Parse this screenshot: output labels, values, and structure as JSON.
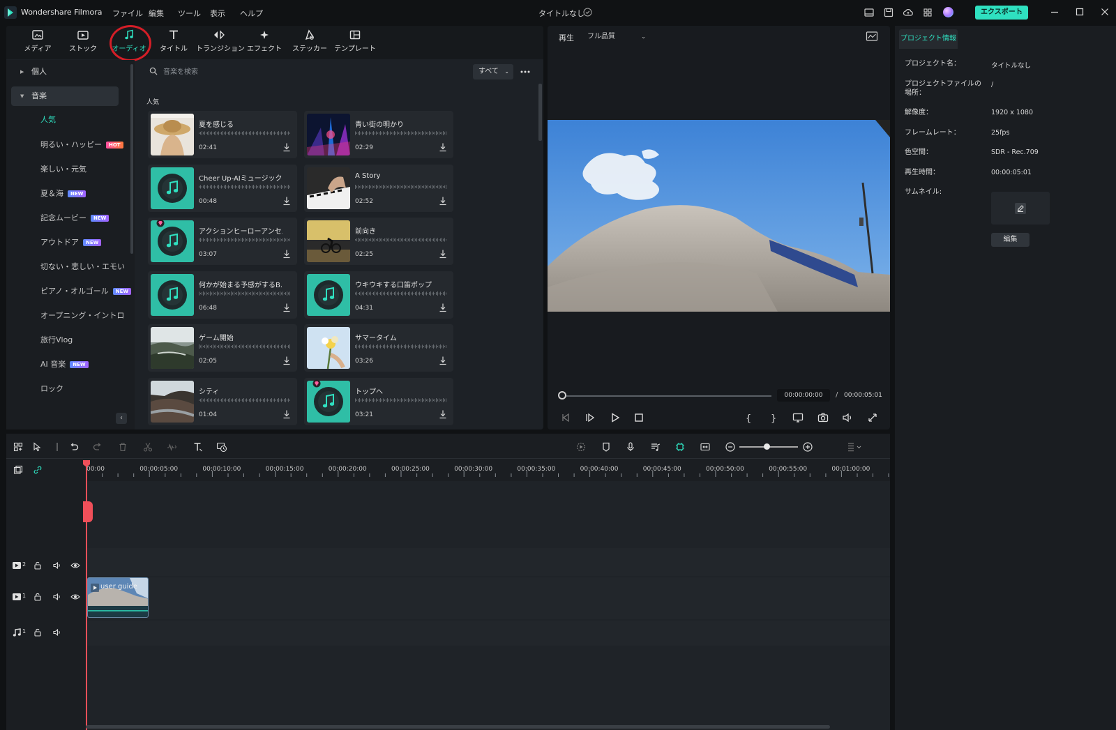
{
  "app": {
    "name": "Wondershare Filmora",
    "doc_title": "タイトルなし",
    "export_label": "エクスポート"
  },
  "menu": [
    "ファイル",
    "編集",
    "ツール",
    "表示",
    "ヘルプ"
  ],
  "tabs": [
    "メディア",
    "ストック",
    "オーディオ",
    "タイトル",
    "トランジション",
    "エフェクト",
    "ステッカー",
    "テンプレート"
  ],
  "sidebar": {
    "parents": [
      "個人",
      "音楽"
    ],
    "items": [
      {
        "label": "人気",
        "badge": ""
      },
      {
        "label": "明るい・ハッピー",
        "badge": "HOT"
      },
      {
        "label": "楽しい・元気",
        "badge": ""
      },
      {
        "label": "夏＆海",
        "badge": "NEW"
      },
      {
        "label": "記念ムービー",
        "badge": "NEW"
      },
      {
        "label": "アウトドア",
        "badge": "NEW"
      },
      {
        "label": "切ない・悲しい・エモい",
        "badge": ""
      },
      {
        "label": "ピアノ・オルゴール",
        "badge": "NEW"
      },
      {
        "label": "オープニング・イントロ",
        "badge": ""
      },
      {
        "label": "旅行Vlog",
        "badge": ""
      },
      {
        "label": "AI 音楽",
        "badge": "NEW"
      },
      {
        "label": "ロック",
        "badge": ""
      }
    ]
  },
  "search": {
    "placeholder": "音楽を検索",
    "filter": "すべて"
  },
  "section_title": "人気",
  "tracks": [
    {
      "title": "夏を感じる",
      "duration": "02:41"
    },
    {
      "title": "青い街の明かり",
      "duration": "02:29"
    },
    {
      "title": "Cheer Up-AIミュージック",
      "duration": "00:48"
    },
    {
      "title": "A Story",
      "duration": "02:52"
    },
    {
      "title": "アクションヒーローアンセム",
      "duration": "03:07"
    },
    {
      "title": "前向き",
      "duration": "02:25"
    },
    {
      "title": "何かが始まる予感がするB...",
      "duration": "06:48"
    },
    {
      "title": "ウキウキする口笛ポップ",
      "duration": "04:31"
    },
    {
      "title": "ゲーム開始",
      "duration": "02:05"
    },
    {
      "title": "サマータイム",
      "duration": "03:26"
    },
    {
      "title": "シティ",
      "duration": "01:04"
    },
    {
      "title": "トップへ",
      "duration": "03:21"
    }
  ],
  "player": {
    "label": "再生",
    "quality": "フル品質",
    "current_time": "00:00:00:00",
    "separator": "/",
    "total_time": "00:00:05:01"
  },
  "project_info": {
    "tab": "プロジェクト情報",
    "rows": [
      {
        "label": "プロジェクト名：",
        "value": "タイトルなし"
      },
      {
        "label": "プロジェクトファイルの場所：",
        "value": "/"
      },
      {
        "label": "解像度：",
        "value": "1920 x 1080"
      },
      {
        "label": "フレームレート：",
        "value": "25fps"
      },
      {
        "label": "色空間：",
        "value": "SDR - Rec.709"
      },
      {
        "label": "再生時間：",
        "value": "00:00:05:01"
      },
      {
        "label": "サムネイル:",
        "value": ""
      }
    ],
    "edit_label": "編集"
  },
  "timeline": {
    "ticks": [
      "00:00",
      "00:00:05:00",
      "00:00:10:00",
      "00:00:15:00",
      "00:00:20:00",
      "00:00:25:00",
      "00:00:30:00",
      "00:00:35:00",
      "00:00:40:00",
      "00:00:45:00",
      "00:00:50:00",
      "00:00:55:00",
      "00:01:00:00"
    ],
    "tracks": [
      "2",
      "1",
      "1"
    ],
    "clip_label": "user guide"
  },
  "colors": {
    "accent": "#2fe0c0",
    "playhead": "#ef4f59",
    "highlight_circle": "#d41e27"
  }
}
